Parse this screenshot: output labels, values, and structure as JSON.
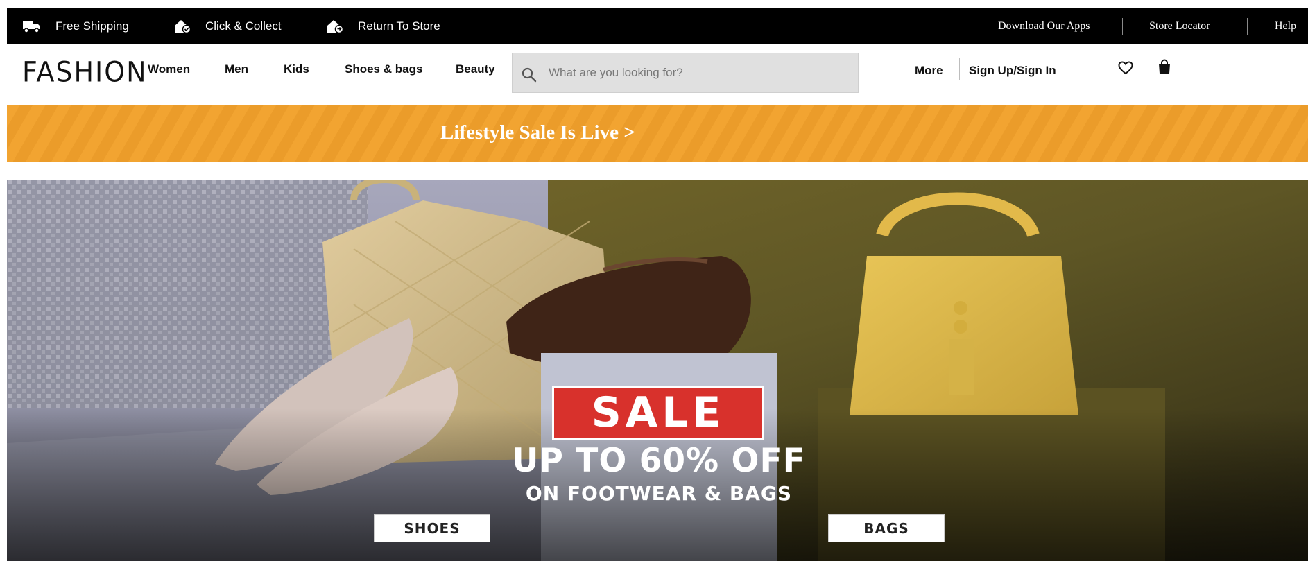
{
  "utility_bar": {
    "items": [
      {
        "label": "Free Shipping",
        "icon": "truck-icon"
      },
      {
        "label": "Click & Collect",
        "icon": "home-check-icon"
      },
      {
        "label": "Return To Store",
        "icon": "home-return-icon"
      }
    ],
    "right_links": [
      "Download Our Apps",
      "Store Locator",
      "Help"
    ]
  },
  "header": {
    "logo": "FASHION",
    "nav": [
      "Women",
      "Men",
      "Kids",
      "Shoes & bags",
      "Beauty"
    ],
    "search": {
      "placeholder": "What are you looking for?",
      "icon": "search-icon"
    },
    "more_label": "More",
    "signin_label": "Sign Up/Sign In",
    "icons": [
      "heart-icon",
      "shopping-bag-icon"
    ]
  },
  "promo": {
    "text": "Lifestyle Sale Is Live  >",
    "color": "#f2a431"
  },
  "hero": {
    "badge": "SALE",
    "headline": "UP TO 60% OFF",
    "subheadline": "ON FOOTWEAR & BAGS",
    "buttons": [
      "SHOES",
      "BAGS"
    ],
    "badge_color": "#d8312c"
  }
}
